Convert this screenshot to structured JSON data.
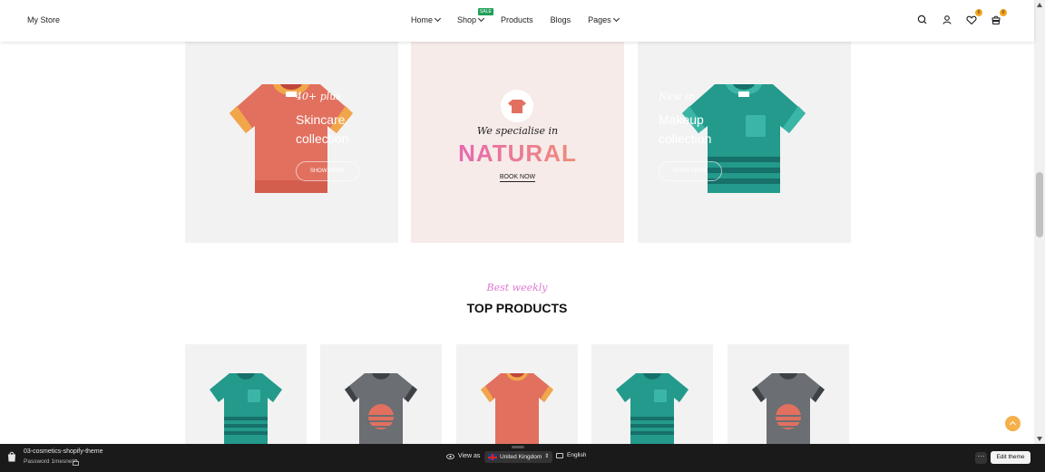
{
  "header": {
    "logo": "My Store",
    "nav": [
      {
        "label": "Home",
        "dropdown": true
      },
      {
        "label": "Shop",
        "dropdown": true,
        "badge": "SALE"
      },
      {
        "label": "Products",
        "dropdown": false
      },
      {
        "label": "Blogs",
        "dropdown": false
      },
      {
        "label": "Pages",
        "dropdown": true
      }
    ],
    "icons": [
      "search-icon",
      "account-icon",
      "wishlist-icon",
      "cart-icon"
    ],
    "wishlist_count": "0",
    "cart_count": "0"
  },
  "banners": [
    {
      "subtitle": "40+ plus",
      "title": "Skincare collection",
      "button": "SHOW MORE",
      "shirt_color": "#e2705f"
    },
    {
      "subtitle": "We specialise in",
      "title": "NATURAL",
      "link": "BOOK NOW"
    },
    {
      "subtitle": "New in",
      "title": "Makeup collection",
      "button": "SHOW MORE",
      "shirt_color": "#239a8b"
    }
  ],
  "section": {
    "subtitle": "Best weekly",
    "title": "TOP PRODUCTS"
  },
  "products": [
    {
      "style": "teal-striped"
    },
    {
      "style": "grey-sunset"
    },
    {
      "style": "coral"
    },
    {
      "style": "teal-striped"
    },
    {
      "style": "grey-sunset"
    }
  ],
  "admin_bar": {
    "theme_name": "03-cosmetics-shopify-theme",
    "password": "Password 1mesnet",
    "view_as": "View as",
    "country": "United Kingdom",
    "language": "English",
    "more": "···",
    "edit_theme": "Edit theme"
  },
  "colors": {
    "accent": "#f5b04a",
    "sale_badge": "#21a05a",
    "gradient_start": "#e45ac8",
    "gradient_end": "#f29a63",
    "teal": "#239a8b",
    "coral": "#e2705f",
    "grey": "#6b6e72"
  }
}
